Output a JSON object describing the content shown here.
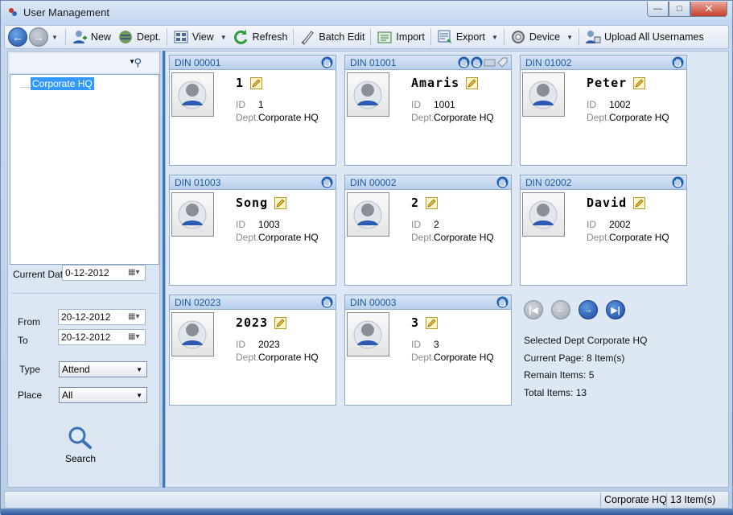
{
  "window": {
    "title": "User Management"
  },
  "toolbar": {
    "items": [
      {
        "label": "New",
        "icon": "new-user-icon"
      },
      {
        "label": "Dept.",
        "icon": "department-icon"
      },
      {
        "label": "View",
        "icon": "view-icon",
        "dropdown": true
      },
      {
        "label": "Refresh",
        "icon": "refresh-icon"
      },
      {
        "label": "Batch Edit",
        "icon": "batch-edit-icon"
      },
      {
        "label": "Import",
        "icon": "import-icon"
      },
      {
        "label": "Export",
        "icon": "export-icon",
        "dropdown": true
      },
      {
        "label": "Device",
        "icon": "device-icon",
        "dropdown": true
      },
      {
        "label": "Upload All Usernames",
        "icon": "upload-icon"
      }
    ]
  },
  "tree": {
    "root": "Corporate HQ"
  },
  "filters": {
    "current_date_label": "Current Date",
    "current_date_value": "0-12-2012",
    "from_label": "From",
    "from_value": "20-12-2012",
    "to_label": "To",
    "to_value": "20-12-2012",
    "type_label": "Type",
    "type_value": "Attend",
    "place_label": "Place",
    "place_value": "All",
    "search_label": "Search"
  },
  "cards": [
    {
      "din": "DIN 00001",
      "name": "1",
      "id_label": "ID",
      "id": "1",
      "dept_label": "Dept.",
      "dept": "Corporate HQ",
      "hands": 1,
      "extra_icons": false
    },
    {
      "din": "DIN 01001",
      "name": "Amaris",
      "id_label": "ID",
      "id": "1001",
      "dept_label": "Dept.",
      "dept": "Corporate HQ",
      "hands": 2,
      "extra_icons": true
    },
    {
      "din": "DIN 01002",
      "name": "Peter",
      "id_label": "ID",
      "id": "1002",
      "dept_label": "Dept.",
      "dept": "Corporate HQ",
      "hands": 1,
      "extra_icons": false
    },
    {
      "din": "DIN 01003",
      "name": "Song",
      "id_label": "ID",
      "id": "1003",
      "dept_label": "Dept.",
      "dept": "Corporate HQ",
      "hands": 1,
      "extra_icons": false
    },
    {
      "din": "DIN 00002",
      "name": "2",
      "id_label": "ID",
      "id": "2",
      "dept_label": "Dept.",
      "dept": "Corporate HQ",
      "hands": 1,
      "extra_icons": false
    },
    {
      "din": "DIN 02002",
      "name": "David",
      "id_label": "ID",
      "id": "2002",
      "dept_label": "Dept.",
      "dept": "Corporate HQ",
      "hands": 1,
      "extra_icons": false
    },
    {
      "din": "DIN 02023",
      "name": "2023",
      "id_label": "ID",
      "id": "2023",
      "dept_label": "Dept.",
      "dept": "Corporate HQ",
      "hands": 1,
      "extra_icons": false
    },
    {
      "din": "DIN 00003",
      "name": "3",
      "id_label": "ID",
      "id": "3",
      "dept_label": "Dept.",
      "dept": "Corporate HQ",
      "hands": 1,
      "extra_icons": false
    }
  ],
  "info": {
    "selected_dept_label": "Selected Dept",
    "selected_dept_value": "Corporate HQ",
    "current_page": "Current Page: 8 Item(s)",
    "remain_items": "Remain Items: 5",
    "total_items": "Total Items: 13"
  },
  "status": {
    "dept": "Corporate HQ",
    "count": "13 Item(s)"
  },
  "colors": {
    "accent": "#3a78c7",
    "din_text": "#1e5aa0",
    "selection": "#3399ff"
  }
}
